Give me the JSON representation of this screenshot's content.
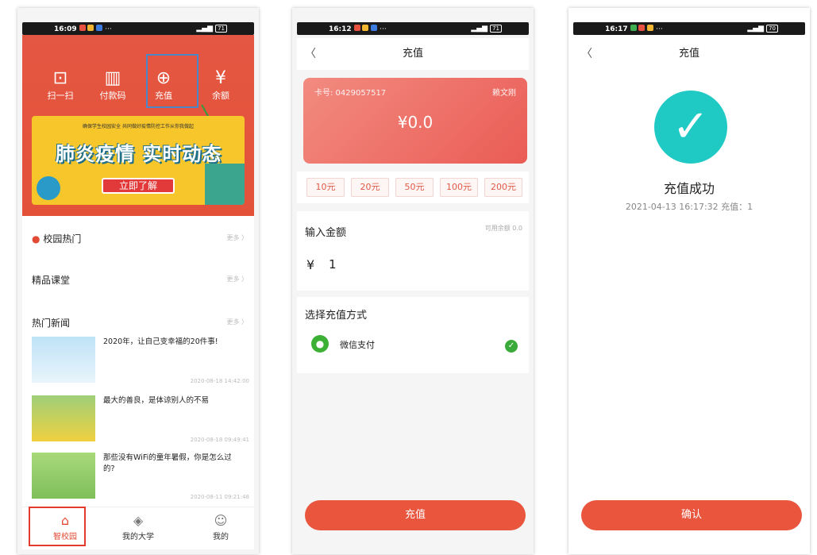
{
  "phone1": {
    "status": {
      "time": "16:09",
      "dots": "···",
      "battery": "71"
    },
    "quick_actions": [
      {
        "icon": "scan-icon",
        "glyph": "⊡",
        "label": "扫一扫"
      },
      {
        "icon": "barcode-icon",
        "glyph": "▥",
        "label": "付款码"
      },
      {
        "icon": "recharge-icon",
        "glyph": "⊕",
        "label": "充值"
      },
      {
        "icon": "money-bag-icon",
        "glyph": "¥",
        "label": "余额"
      }
    ],
    "banner": {
      "small_text": "确保学生校园安全 共同做好疫情防控工作从你我做起",
      "big_text": "肺炎疫情 实时动态",
      "button": "立即了解"
    },
    "sections": [
      {
        "title": "校园热门",
        "more": "更多 〉"
      },
      {
        "title": "精品课堂",
        "more": "更多 〉"
      },
      {
        "title": "热门新闻",
        "more": "更多 〉"
      }
    ],
    "news": [
      {
        "title": "2020年，让自己变幸福的20件事!",
        "time": "2020-08-18 14:42:00"
      },
      {
        "title": "最大的善良，是体谅别人的不易",
        "time": "2020-08-18 09:49:41"
      },
      {
        "title": "那些没有WiFi的童年暑假，你是怎么过的?",
        "time": "2020-08-11 09:21:48"
      }
    ],
    "tabs": [
      {
        "icon": "home-icon",
        "glyph": "⌂",
        "label": "智校园"
      },
      {
        "icon": "layers-icon",
        "glyph": "◈",
        "label": "我的大学"
      },
      {
        "icon": "user-icon",
        "glyph": "☺",
        "label": "我的"
      }
    ]
  },
  "phone2": {
    "status": {
      "time": "16:12",
      "dots": "···",
      "battery": "71"
    },
    "title": "充值",
    "back": "〈",
    "card": {
      "number": "卡号: 0429057517",
      "name": "赖文刚",
      "amount": "¥0.0"
    },
    "amounts": [
      "10元",
      "20元",
      "50元",
      "100元",
      "200元"
    ],
    "input_label": "输入金额",
    "balance": "可用余额 0.0",
    "currency": "¥",
    "input_value": "1",
    "pay_label": "选择充值方式",
    "pay_method": "微信支付",
    "submit": "充值"
  },
  "phone3": {
    "status": {
      "time": "16:17",
      "dots": "···",
      "battery": "70"
    },
    "title": "充值",
    "back": "〈",
    "success_title": "充值成功",
    "success_detail": "2021-04-13 16:17:32 充值：1",
    "confirm": "确认"
  },
  "colors": {
    "brand_red": "#e45742",
    "success_teal": "#1fc9c4",
    "wechat_green": "#3cb034"
  }
}
